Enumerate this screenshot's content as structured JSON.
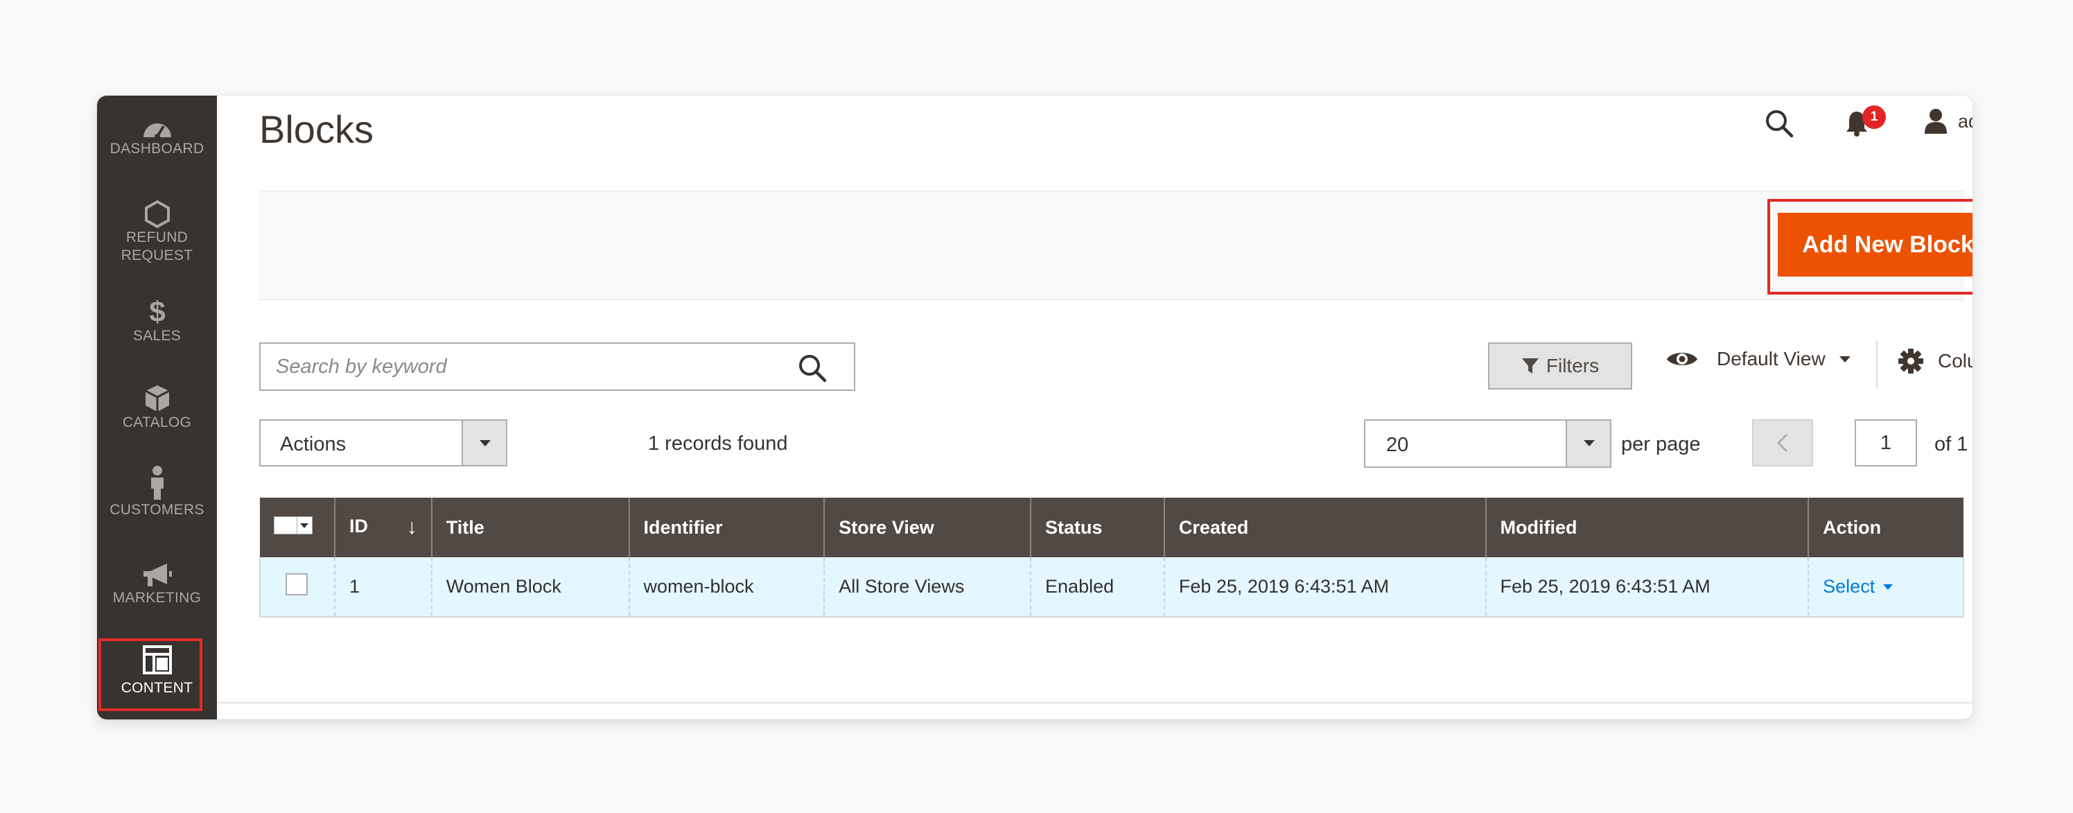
{
  "sidebar": {
    "items": [
      {
        "label": "DASHBOARD",
        "icon": "dashboard-icon"
      },
      {
        "label": "REFUND\nREQUEST",
        "icon": "hexagon-icon"
      },
      {
        "label": "SALES",
        "icon": "dollar-icon"
      },
      {
        "label": "CATALOG",
        "icon": "box-icon"
      },
      {
        "label": "CUSTOMERS",
        "icon": "person-icon"
      },
      {
        "label": "MARKETING",
        "icon": "megaphone-icon"
      },
      {
        "label": "CONTENT",
        "icon": "layout-icon",
        "active": true
      }
    ]
  },
  "page": {
    "title": "Blocks"
  },
  "header": {
    "notifications_count": "1",
    "user_name": "admin"
  },
  "action_bar": {
    "add_button_label": "Add New Block"
  },
  "toolbar": {
    "search_placeholder": "Search by keyword",
    "filters_label": "Filters",
    "view_label": "Default View",
    "columns_label": "Columns",
    "mass_actions_value": "Actions",
    "records_found": "1 records found",
    "per_page_value": "20",
    "per_page_label": "per page",
    "page_current": "1",
    "page_of": "of 1"
  },
  "grid": {
    "headers": [
      "ID",
      "Title",
      "Identifier",
      "Store View",
      "Status",
      "Created",
      "Modified",
      "Action"
    ],
    "sort_indicator": "↓",
    "rows": [
      {
        "id": "1",
        "title": "Women Block",
        "identifier": "women-block",
        "store_view": "All Store Views",
        "status": "Enabled",
        "created": "Feb 25, 2019 6:43:51 AM",
        "modified": "Feb 25, 2019 6:43:51 AM",
        "action": "Select"
      }
    ]
  },
  "colors": {
    "sidebar_bg": "#373330",
    "primary_button": "#eb5202",
    "highlight_border": "#e02b27",
    "grid_header": "#514943",
    "row_bg": "#e5f7fe",
    "link": "#007bdb",
    "badge": "#e22626"
  }
}
